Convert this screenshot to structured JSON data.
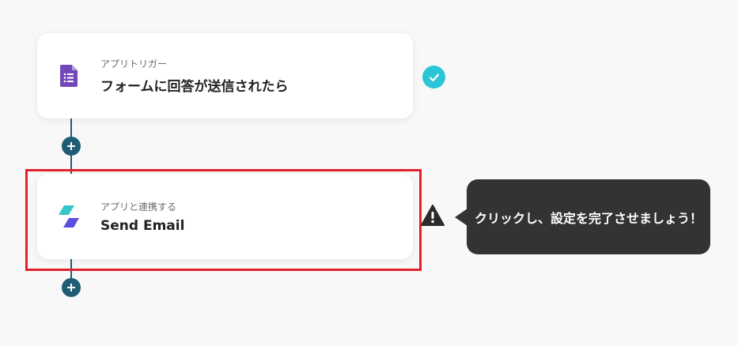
{
  "flow": {
    "trigger": {
      "sub_label": "アプリトリガー",
      "title": "フォームに回答が送信されたら",
      "icon": "google-forms-icon",
      "status": "complete"
    },
    "action": {
      "sub_label": "アプリと連携する",
      "title": "Send Email",
      "icon": "yoom-mail-icon",
      "status": "warning"
    }
  },
  "tooltip": {
    "text": "クリックし、設定を完了させましょう！"
  },
  "colors": {
    "accent_teal": "#2ac6d8",
    "connector": "#1f5c76",
    "highlight_red": "#e3212b",
    "tooltip_bg": "#333333"
  }
}
